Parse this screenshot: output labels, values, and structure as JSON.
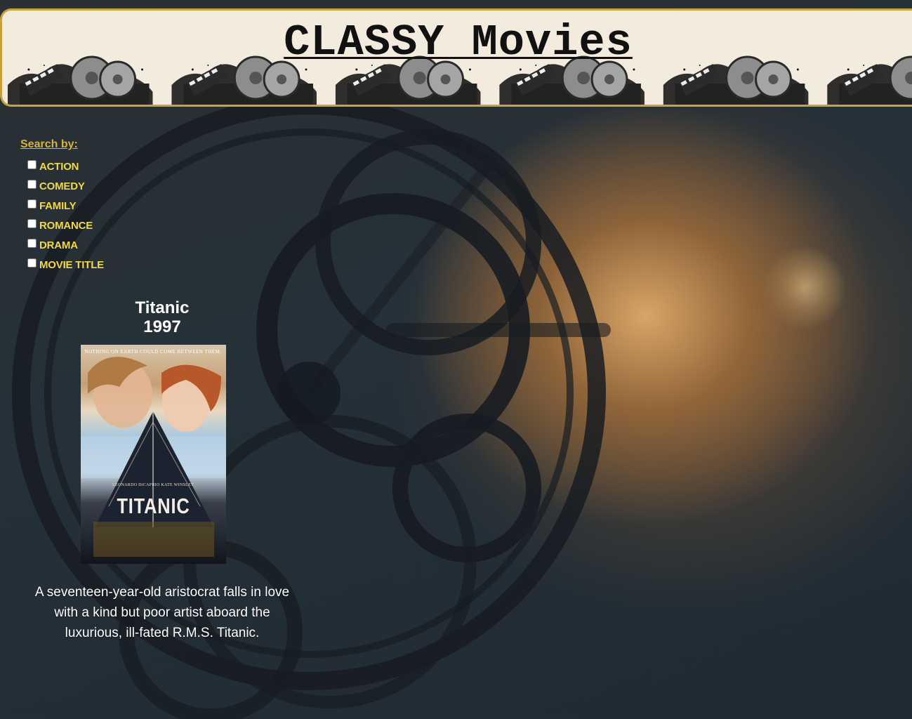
{
  "header": {
    "title": "CLASSY Movies"
  },
  "search": {
    "label": "Search by:",
    "filters": [
      {
        "label": "ACTION",
        "checked": false
      },
      {
        "label": "COMEDY",
        "checked": false
      },
      {
        "label": "FAMILY",
        "checked": false
      },
      {
        "label": "ROMANCE",
        "checked": false
      },
      {
        "label": "DRAMA",
        "checked": false
      },
      {
        "label": "MOVIE TITLE",
        "checked": false
      }
    ]
  },
  "movie": {
    "title": "Titanic",
    "year": "1997",
    "poster": {
      "tagline": "NOTHING ON EARTH COULD COME BETWEEN THEM.",
      "actors": "LEONARDO DiCAPRIO   KATE WINSLET",
      "name": "TITANIC"
    },
    "description": "A seventeen-year-old aristocrat falls in love with a kind but poor artist aboard the luxurious, ill-fated R.M.S. Titanic."
  },
  "colors": {
    "accent_gold": "#d7b33a",
    "filter_label": "#f0d84a",
    "banner_bg": "#f2ebde",
    "banner_border": "#c9a33a"
  }
}
